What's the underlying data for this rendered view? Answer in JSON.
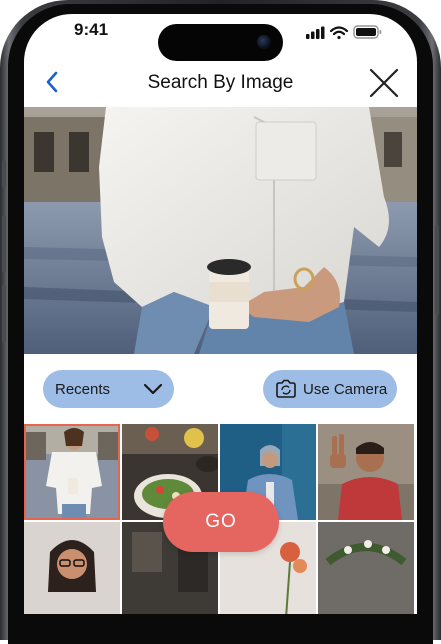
{
  "status_bar": {
    "time": "9:41"
  },
  "nav": {
    "title": "Search By Image",
    "back_icon": "chevron-left-icon",
    "close_icon": "close-icon"
  },
  "controls": {
    "recents_label": "Recents",
    "camera_label": "Use Camera"
  },
  "grid": {
    "tiles": [
      {
        "subject": "woman in white shirt holding coffee",
        "selected": true
      },
      {
        "subject": "salad bowl and food table",
        "selected": false
      },
      {
        "subject": "person in denim jacket by blue wall",
        "selected": false
      },
      {
        "subject": "man making peace sign",
        "selected": false
      },
      {
        "subject": "woman with glasses",
        "selected": false
      },
      {
        "subject": "dark interior scene",
        "selected": false
      },
      {
        "subject": "flowers",
        "selected": false
      },
      {
        "subject": "wreath decoration",
        "selected": false
      }
    ]
  },
  "actions": {
    "go_label": "GO"
  },
  "colors": {
    "accent_blue": "#9dbde6",
    "back_chevron": "#1a5fd6",
    "go_button": "#e56561",
    "selection_outline": "#e8644f"
  }
}
